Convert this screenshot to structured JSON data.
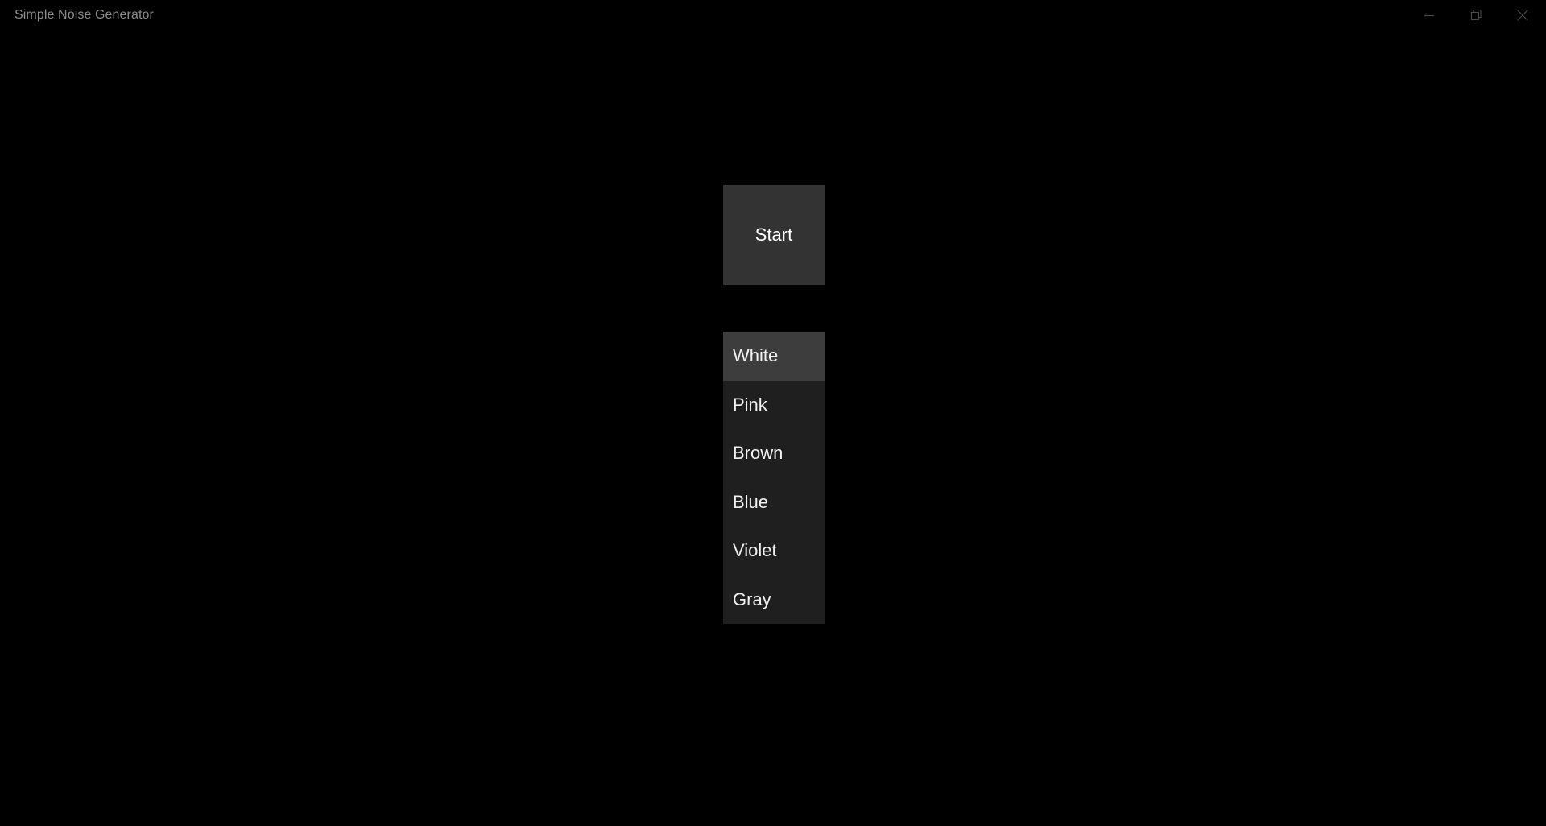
{
  "window": {
    "title": "Simple Noise Generator",
    "controls": [
      {
        "name": "minimize-button",
        "label": "Minimize",
        "icon": "minimize-icon"
      },
      {
        "name": "restore-button",
        "label": "Restore",
        "icon": "restore-icon"
      },
      {
        "name": "close-button",
        "label": "Close",
        "icon": "close-icon"
      }
    ]
  },
  "main": {
    "start_button_label": "Start",
    "noise_types": [
      {
        "label": "White",
        "selected": true
      },
      {
        "label": "Pink",
        "selected": false
      },
      {
        "label": "Brown",
        "selected": false
      },
      {
        "label": "Blue",
        "selected": false
      },
      {
        "label": "Violet",
        "selected": false
      },
      {
        "label": "Gray",
        "selected": false
      }
    ]
  },
  "colors": {
    "app_background": "#000000",
    "title_text": "#8c8c8c",
    "button_background": "#333333",
    "button_text": "#ffffff",
    "list_background": "#1f1f1f",
    "list_selected_background": "#3d3d3d",
    "list_text": "#f2f2f2",
    "chrome_icon": "#4a4a4a"
  }
}
